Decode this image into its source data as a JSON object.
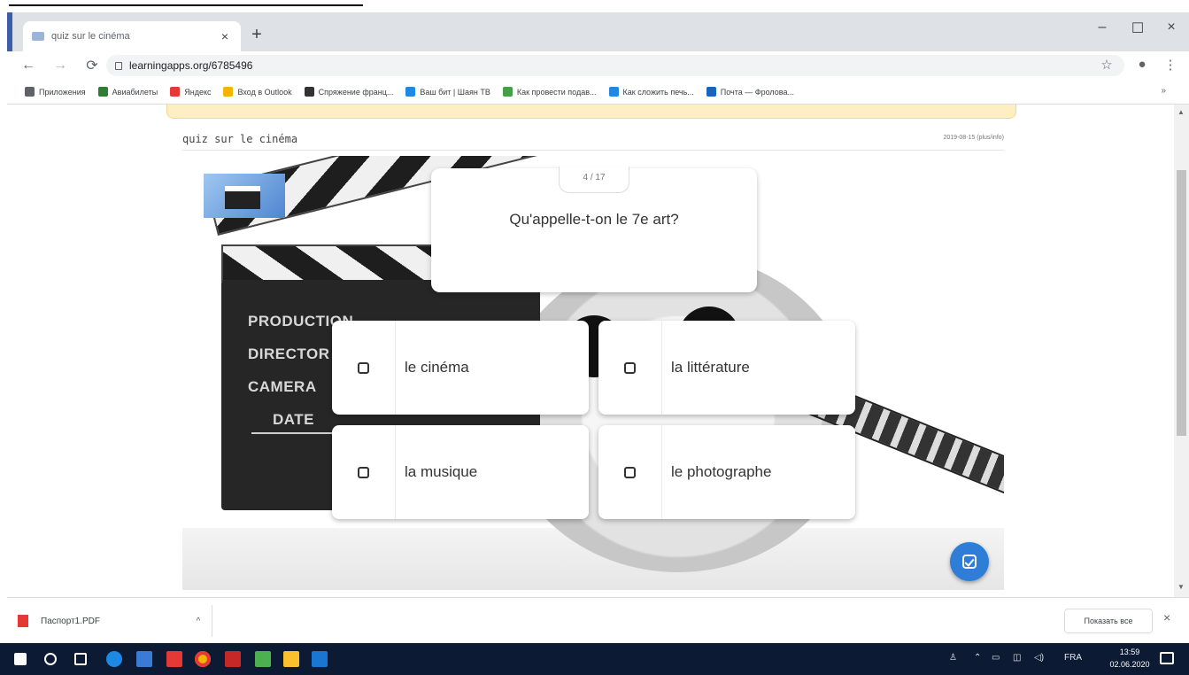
{
  "browser": {
    "tab_title": "quiz sur le cinéma",
    "tab_close": "×",
    "new_tab": "+",
    "win_min": "–",
    "win_max": "☐",
    "win_close": "×",
    "url": "learningapps.org/6785496",
    "bookmarks": [
      {
        "label": "Приложения",
        "color": "#5f6368"
      },
      {
        "label": "Авиабилеты",
        "color": "#2e7d32"
      },
      {
        "label": "Яндекс",
        "color": "#e53935"
      },
      {
        "label": "Вход в Outlook",
        "color": "#f4b400"
      },
      {
        "label": "Спряжение франц...",
        "color": "#333333"
      },
      {
        "label": "Ваш бит | Шаян ТВ",
        "color": "#1e88e5"
      },
      {
        "label": "Как провести подав...",
        "color": "#43a047"
      },
      {
        "label": "Как сложить печь...",
        "color": "#1e88e5"
      },
      {
        "label": "Почта — Фролова...",
        "color": "#1565c0"
      }
    ],
    "bookmarks_more": "»"
  },
  "app": {
    "title": "quiz sur le cinéma",
    "date": "2019-08-15 (plus/info)"
  },
  "quiz": {
    "counter": "4 / 17",
    "question": "Qu'appelle-t-on le 7e art?",
    "answers": [
      "le cinéma",
      "la littérature",
      "la musique",
      "le photographe"
    ]
  },
  "clapper": {
    "lines": [
      "PRODUCTION",
      "DIRECTOR",
      "CAMERA",
      "DATE"
    ]
  },
  "downloads": {
    "file": "Паспорт1.PDF",
    "show_all": "Показать все",
    "close": "×",
    "chevron": "^"
  },
  "taskbar": {
    "lang": "FRA",
    "time": "13:59",
    "date": "02.06.2020"
  },
  "colors": {
    "accent": "#2e7ed8",
    "taskbar": "#0c1a33"
  }
}
